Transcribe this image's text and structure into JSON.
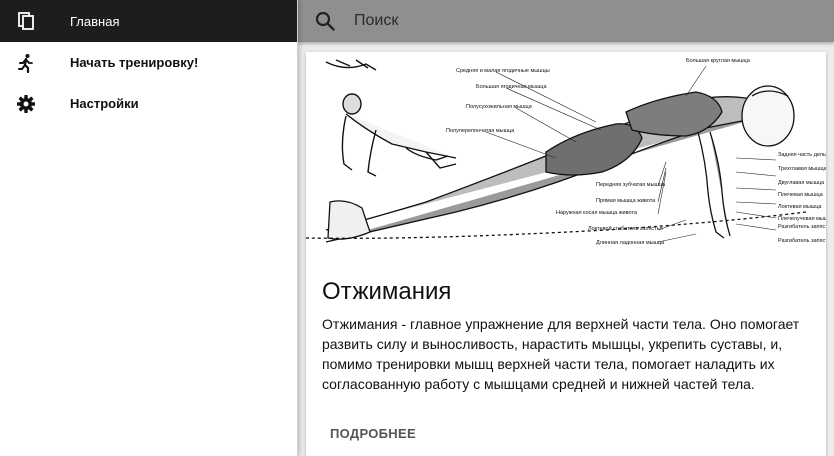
{
  "drawer": {
    "items": [
      {
        "label": "Главная",
        "icon": "copy-icon",
        "active": true
      },
      {
        "label": "Начать тренировку!",
        "icon": "running-person-icon",
        "active": false
      },
      {
        "label": "Настройки",
        "icon": "gear-icon",
        "active": false
      }
    ]
  },
  "search": {
    "placeholder": "Поиск",
    "value": ""
  },
  "card": {
    "image_labels": [
      "Большая круглая мышца",
      "Средняя и малая ягодичные мышцы",
      "Большая ягодичная мышца",
      "Полусухожильная мышца",
      "Полуперепончатая мышца",
      "Задняя часть дельтовидной мышцы",
      "Трехглавая мышца плеча",
      "Двуглавая мышца плеча",
      "Плечевая мышца",
      "Локтевая мышца",
      "Плечелучевая мышца",
      "Разгибатель запястья лучевой",
      "Разгибатель запястья локтевой",
      "Передняя зубчатая мышца",
      "Прямая мышца живота",
      "Наружная косая мышца живота",
      "Локтевой сгибатель запястья",
      "Длинная ладонная мышца"
    ],
    "title": "Отжимания",
    "text": "Отжимания - главное упражнение для верхней части тела. Оно помогает развить силу и выносливость, нарастить мышцы, укрепить суставы, и, помимо тренировки мышц верхней части тела, помогает наладить их согласованную работу с мышцами средней и нижней частей тела.",
    "action_label": "ПОДРОБНЕЕ"
  },
  "colors": {
    "drawer_active": "#1d1d1d",
    "topbar": "#8f8f8f",
    "background": "#ececec"
  }
}
